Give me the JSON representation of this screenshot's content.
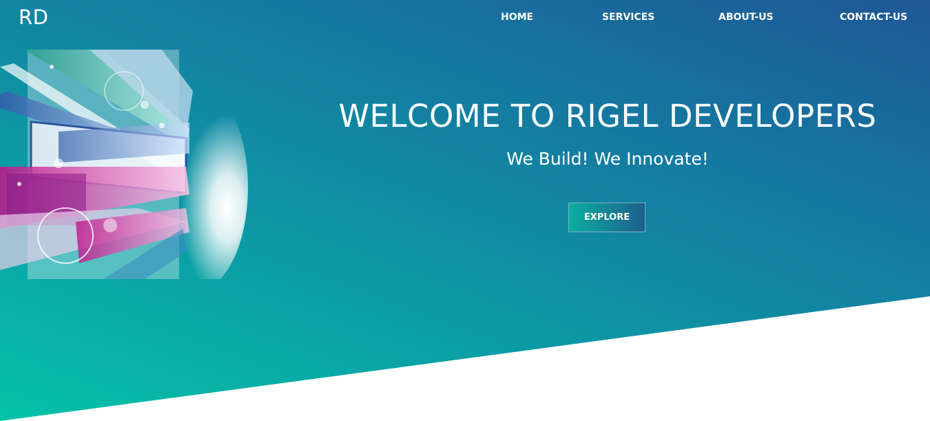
{
  "brand": {
    "logo_text": "RD"
  },
  "nav": {
    "items": [
      {
        "label": "HOME"
      },
      {
        "label": "SERVICES"
      },
      {
        "label": "ABOUT-US"
      },
      {
        "label": "CONTACT-US"
      }
    ]
  },
  "hero": {
    "title": "WELCOME TO RIGEL DEVELOPERS",
    "subtitle": "We Build! We Innovate!",
    "cta_label": "EXPLORE"
  },
  "colors": {
    "gradient_top_right": "#1e5796",
    "gradient_bottom_left": "#04c2a8",
    "text": "#ffffff",
    "background_below": "#ffffff"
  },
  "images": {
    "hero_art": "abstract-glass-panels-illustration"
  }
}
